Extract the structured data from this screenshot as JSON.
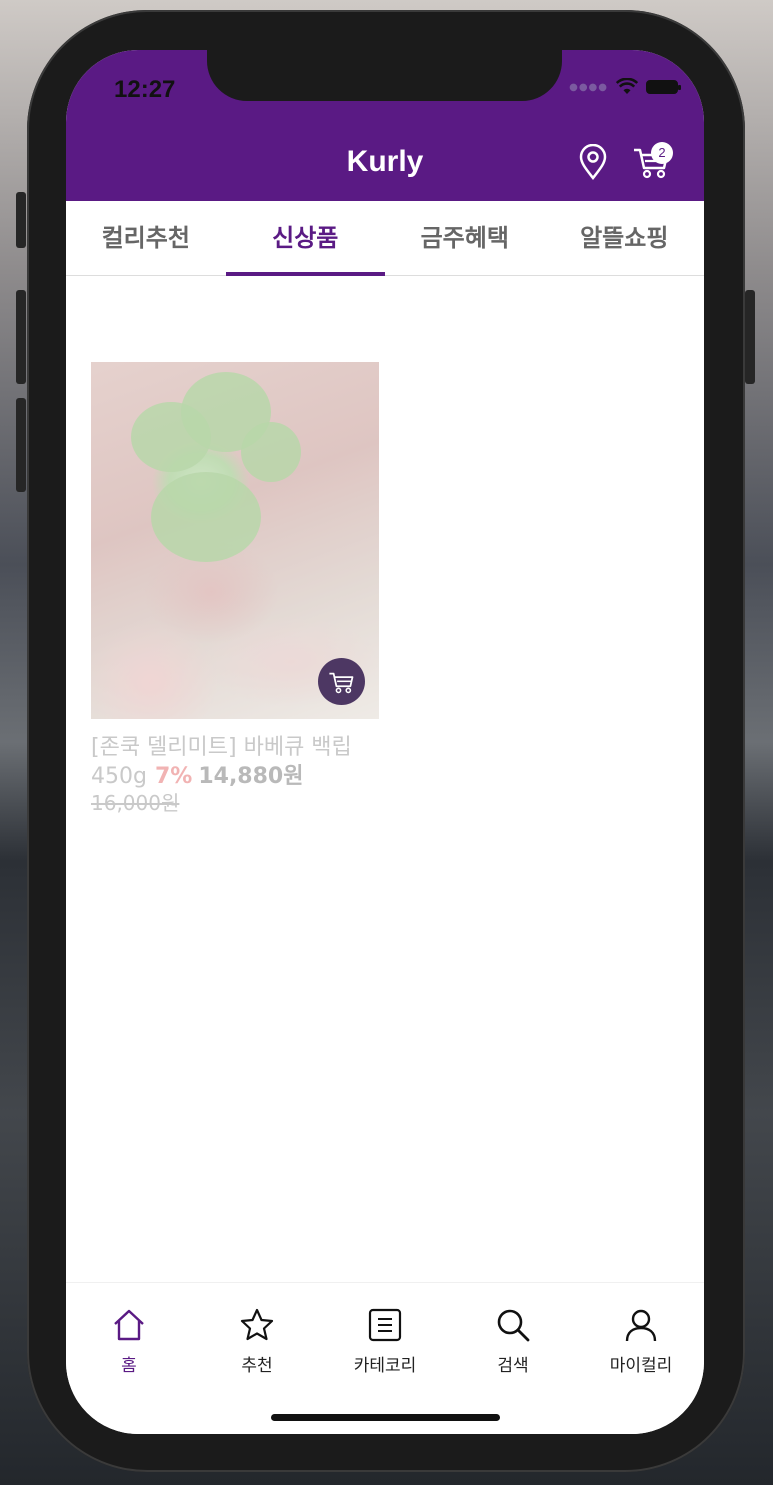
{
  "status_bar": {
    "time": "12:27"
  },
  "header": {
    "title": "Kurly",
    "cart_count": "2",
    "location_icon": "location-pin-icon",
    "cart_icon": "shopping-cart-icon"
  },
  "tabs": [
    {
      "label": "컬리추천",
      "active": false
    },
    {
      "label": "신상품",
      "active": true
    },
    {
      "label": "금주혜택",
      "active": false
    },
    {
      "label": "알뜰쇼핑",
      "active": false
    }
  ],
  "products": [
    {
      "name": "[존쿡 델리미트] 바베큐 백립 450g",
      "discount": "7%",
      "price": "14,880원",
      "original_price": "16,000원",
      "image": "bbq-back-rib-photo",
      "cart_icon": "shopping-cart-icon"
    }
  ],
  "bottom_nav": [
    {
      "label": "홈",
      "icon": "home-icon",
      "active": true
    },
    {
      "label": "추천",
      "icon": "star-icon",
      "active": false
    },
    {
      "label": "카테코리",
      "icon": "category-list-icon",
      "active": false
    },
    {
      "label": "검색",
      "icon": "search-icon",
      "active": false
    },
    {
      "label": "마이컬리",
      "icon": "user-icon",
      "active": false
    }
  ],
  "colors": {
    "brand": "#5a1a84",
    "discount": "#f1b3b3"
  }
}
